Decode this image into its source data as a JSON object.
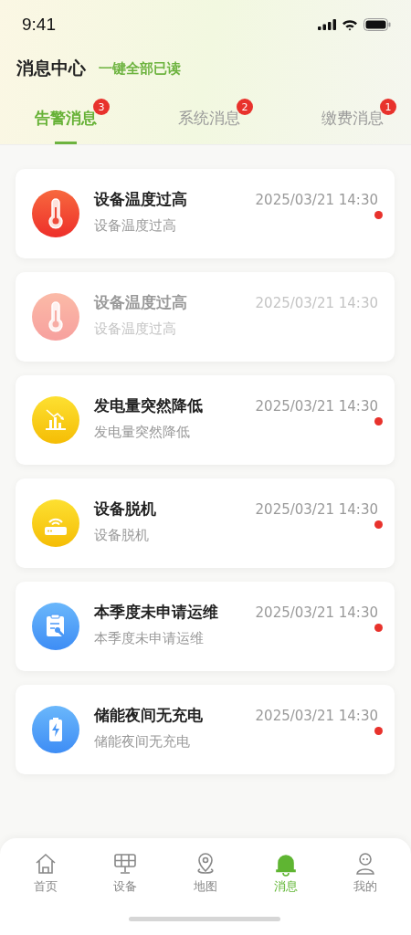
{
  "status_bar": {
    "time": "9:41"
  },
  "header": {
    "title": "消息中心",
    "action": "一键全部已读"
  },
  "tabs": [
    {
      "label": "告警消息",
      "badge": "3",
      "selected": true
    },
    {
      "label": "系统消息",
      "badge": "2",
      "selected": false
    },
    {
      "label": "缴费消息",
      "badge": "1",
      "selected": false
    }
  ],
  "messages": [
    {
      "kind": "temperature",
      "title": "设备温度过高",
      "time": "2025/03/21 14:30",
      "summary": "设备温度过高",
      "unread": true
    },
    {
      "kind": "temperature",
      "title": "设备温度过高",
      "time": "2025/03/21 14:30",
      "summary": "设备温度过高",
      "unread": false
    },
    {
      "kind": "power-drop",
      "title": "发电量突然降低",
      "time": "2025/03/21 14:30",
      "summary": "发电量突然降低",
      "unread": true
    },
    {
      "kind": "offline",
      "title": "设备脱机",
      "time": "2025/03/21 14:30",
      "summary": "设备脱机",
      "unread": true
    },
    {
      "kind": "maintenance",
      "title": "本季度未申请运维",
      "time": "2025/03/21 14:30",
      "summary": "本季度未申请运维",
      "unread": true
    },
    {
      "kind": "storage",
      "title": "储能夜间无充电",
      "time": "2025/03/21 14:30",
      "summary": "储能夜间无充电",
      "unread": true
    }
  ],
  "nav": [
    {
      "kind": "home",
      "label": "首页",
      "selected": false
    },
    {
      "kind": "device",
      "label": "设备",
      "selected": false
    },
    {
      "kind": "map",
      "label": "地图",
      "selected": false
    },
    {
      "kind": "message",
      "label": "消息",
      "selected": true
    },
    {
      "kind": "profile",
      "label": "我的",
      "selected": false
    }
  ]
}
